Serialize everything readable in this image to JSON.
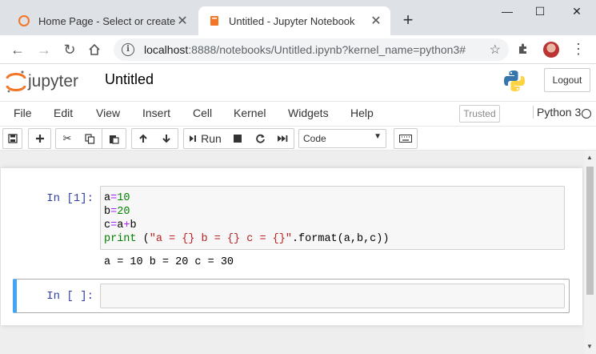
{
  "browser": {
    "tabs": [
      {
        "title": "Home Page - Select or create a notebook",
        "active": false,
        "favicon": "jupyter-favicon"
      },
      {
        "title": "Untitled - Jupyter Notebook",
        "active": true,
        "favicon": "notebook-favicon"
      }
    ],
    "new_tab": "+",
    "window_controls": {
      "minimize": "—",
      "maximize": "☐",
      "close": "✕"
    },
    "url_host": "localhost",
    "url_rest": ":8888/notebooks/Untitled.ipynb?kernel_name=python3#",
    "accent": "#f37626"
  },
  "jupyter": {
    "logo_text": "jupyter",
    "notebook_title": "Untitled",
    "logout_label": "Logout",
    "menu": [
      "File",
      "Edit",
      "View",
      "Insert",
      "Cell",
      "Kernel",
      "Widgets",
      "Help"
    ],
    "trusted_label": "Trusted",
    "kernel_name": "Python 3",
    "toolbar": {
      "run_label": "Run",
      "cell_type": "Code"
    }
  },
  "cells": [
    {
      "prompt": "In [1]:",
      "code": {
        "line1": {
          "var": "a",
          "op": "=",
          "num": "10"
        },
        "line2": {
          "var": "b",
          "op": "=",
          "num": "20"
        },
        "line3": {
          "a": "c",
          "op1": "=",
          "b": "a",
          "op2": "+",
          "c": "b"
        },
        "line4": {
          "kw": "print",
          "open": " (",
          "str": "\"a = {} b = {} c = {}\"",
          "rest": ".format(a,b,c))"
        }
      },
      "output": "a = 10 b = 20 c = 30"
    },
    {
      "prompt": "In [ ]:",
      "code": "",
      "selected": true,
      "selection_color": "#42a5f5"
    }
  ]
}
